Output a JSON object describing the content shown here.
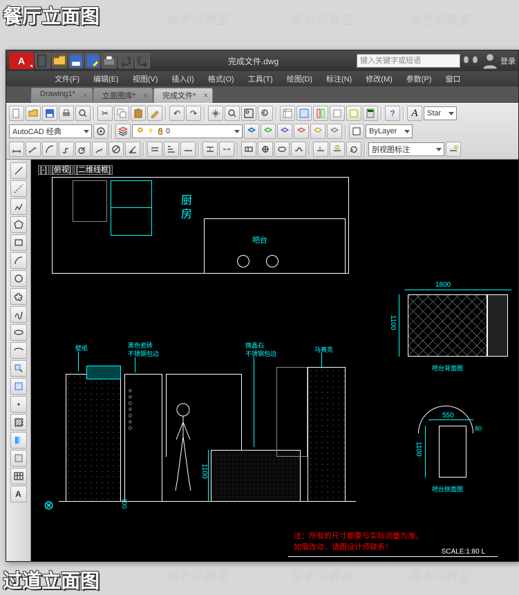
{
  "overlay": {
    "top_title": "餐厅立面图",
    "bottom_title": "过道立面图",
    "wm": "侯老师教室"
  },
  "app": {
    "logo_label": "A",
    "title": "完成文件.dwg",
    "search_placeholder": "键入关键字或短语",
    "login": "登录"
  },
  "qat": [
    "new",
    "open",
    "save",
    "saveas",
    "print",
    "undo",
    "redo"
  ],
  "menu": [
    "文件(F)",
    "编辑(E)",
    "视图(V)",
    "插入(I)",
    "格式(O)",
    "工具(T)",
    "绘图(D)",
    "标注(N)",
    "修改(M)",
    "参数(P)",
    "窗口"
  ],
  "tabs": [
    {
      "label": "Drawing1*",
      "active": false
    },
    {
      "label": "立面图库*",
      "active": false
    },
    {
      "label": "完成文件*",
      "active": true
    }
  ],
  "row2": {
    "workspace_combo": "AutoCAD 经典",
    "dim_value": "0",
    "layer_prop": "ByLayer"
  },
  "row3": {
    "annotate_combo": "剖视图标注"
  },
  "row1_right": {
    "std_label": "Star"
  },
  "canvas": {
    "viewport_label": [
      "[-]",
      "[俯视]",
      "[二维线框]"
    ],
    "kitchen_label": "厨房",
    "bar_label": "吧台",
    "dims": {
      "d1800": "1800",
      "d1100a": "1100",
      "d550": "550",
      "d1100b": "1100",
      "d1100c": "1100",
      "d100": "100",
      "d80": "80"
    },
    "callouts": {
      "c1": "壁纸",
      "c2": "黑色瓷砖",
      "c3": "不锈钢包边",
      "c4": "微晶石",
      "c5": "不锈钢包边",
      "c6": "马赛克"
    },
    "detail_labels": {
      "top": "吧台背面图",
      "bot": "吧台侧面图"
    },
    "note": "注：所有的尺寸都要与实际测量为准，\n如需改动，请跟设计师联系！",
    "scale": "SCALE:1:80  L"
  },
  "text_style_btn": "A"
}
